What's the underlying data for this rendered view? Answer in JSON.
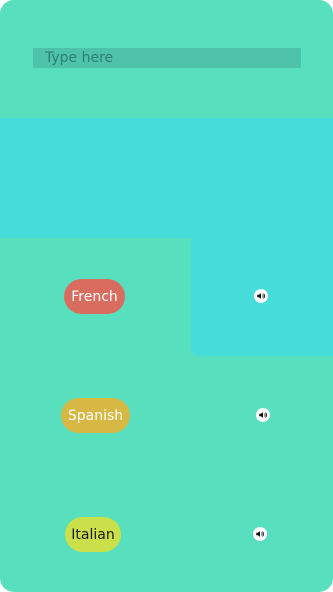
{
  "input": {
    "placeholder": "Type here",
    "value": ""
  },
  "languages": [
    {
      "label": "French",
      "color": "#d86d5f"
    },
    {
      "label": "Spanish",
      "color": "#d8b845"
    },
    {
      "label": "Italian",
      "color": "#c9e04a"
    }
  ],
  "icons": {
    "speaker": "speaker-icon"
  },
  "colors": {
    "background": "#58dfbd",
    "panel": "#45dcd9",
    "input": "#4ec3aa"
  }
}
